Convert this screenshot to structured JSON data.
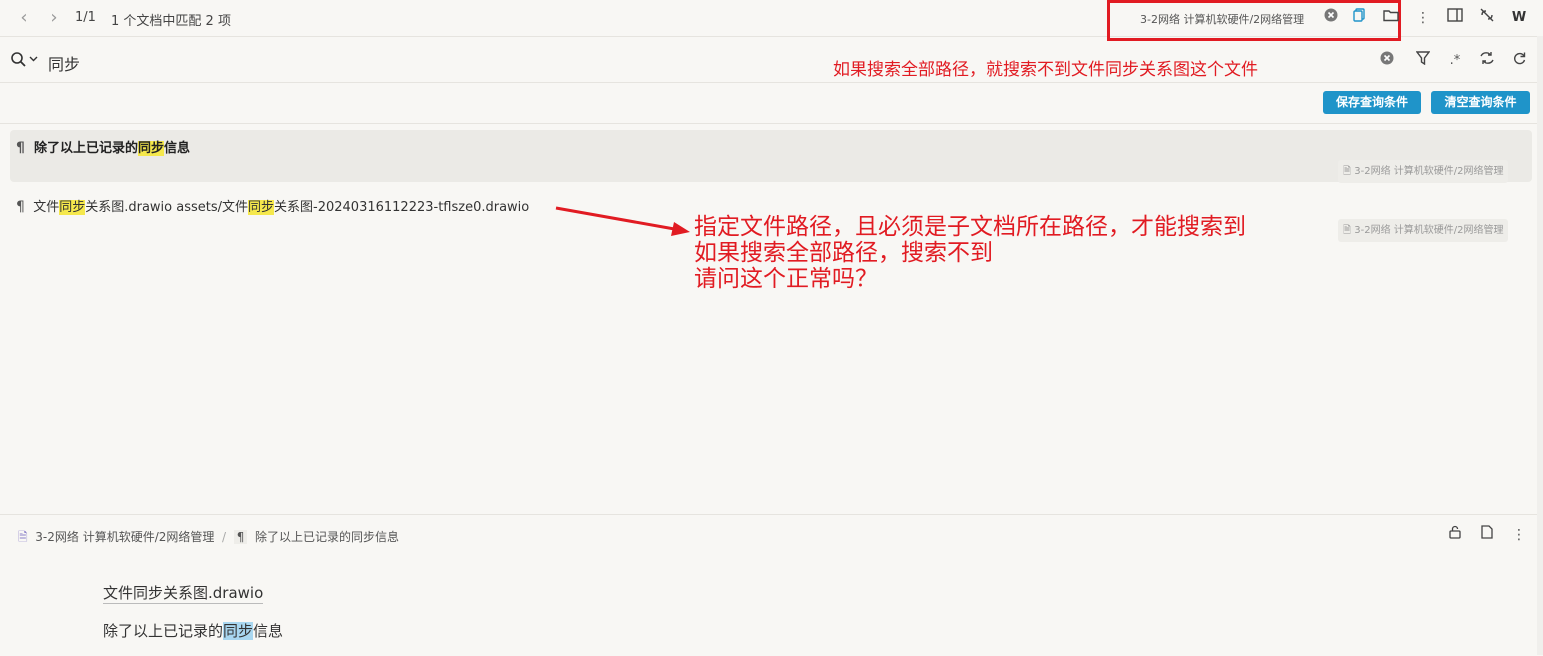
{
  "topbar": {
    "pager": "1/1",
    "match_summary": "1 个文档中匹配 2 项",
    "path": "3-2网络 计算机软硬件/2网络管理",
    "user_initial": "W"
  },
  "search": {
    "query": "同步",
    "annotation": "如果搜索全部路径，就搜索不到文件同步关系图这个文件"
  },
  "actions": {
    "save_label": "保存查询条件",
    "clear_label": "清空查询条件"
  },
  "results": [
    {
      "pre": "除了以上已记录的",
      "hl": "同步",
      "post": "信息",
      "doc": "3-2网络 计算机软硬件/2网络管理"
    },
    {
      "p1": "文件",
      "h1": "同步",
      "p2": "关系图.drawio assets/文件",
      "h2": "同步",
      "p3": "关系图-20240316112223-tflsze0.drawio",
      "doc": "3-2网络 计算机软硬件/2网络管理"
    }
  ],
  "annotation_big": {
    "line1": "指定文件路径，且必须是子文档所在路径，才能搜索到",
    "line2": "如果搜索全部路径，搜索不到",
    "line3": "请问这个正常吗？"
  },
  "preview": {
    "breadcrumb_doc": "3-2网络 计算机软硬件/2网络管理",
    "breadcrumb_sep": "/",
    "breadcrumb_block": "除了以上已记录的同步信息",
    "line1": "文件同步关系图.drawio",
    "line2_pre": "除了以上已记录的",
    "line2_hl": "同步",
    "line2_post": "信息"
  },
  "colors": {
    "accent_blue": "#1f94c9",
    "highlight_yellow": "#f5e84c",
    "highlight_blue": "#a9d7f0",
    "annotation_red": "#e11b22"
  }
}
